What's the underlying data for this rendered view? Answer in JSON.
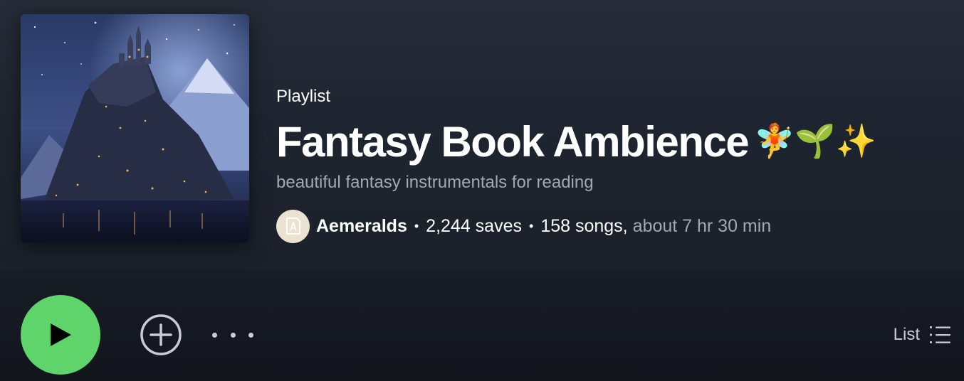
{
  "playlist": {
    "type_label": "Playlist",
    "title": "Fantasy Book Ambience",
    "title_emoji": "🧚🌱✨",
    "description": "beautiful fantasy instrumentals for reading",
    "owner": "Aemeralds",
    "saves": "2,244 saves",
    "songs": "158 songs,",
    "duration": "about 7 hr 30 min",
    "separator": "•"
  },
  "controls": {
    "play_icon": "play-icon",
    "add_icon": "add-circle-icon",
    "more_icon": "more-horizontal-icon",
    "view_label": "List",
    "view_icon": "list-icon"
  },
  "colors": {
    "accent": "#5fd46b",
    "background": "#1f2530",
    "muted_text": "#a3a8b3"
  }
}
